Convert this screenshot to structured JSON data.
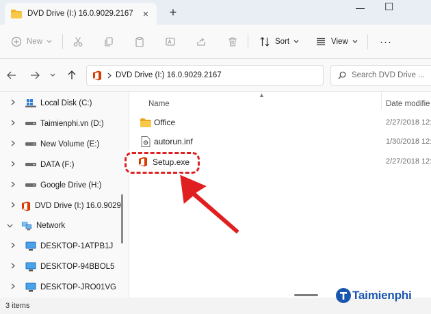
{
  "tab": {
    "title": "DVD Drive (I:) 16.0.9029.2167",
    "close_glyph": "×",
    "new_tab_glyph": "+"
  },
  "window_controls": {
    "minimize": "—",
    "maximize": "☐"
  },
  "command_bar": {
    "new_label": "New",
    "sort_label": "Sort",
    "view_label": "View",
    "more_glyph": "···"
  },
  "address": {
    "path": "DVD Drive (I:) 16.0.9029.2167",
    "search_placeholder": "Search DVD Drive ..."
  },
  "sidebar": {
    "items": [
      {
        "label": "Local Disk (C:)",
        "icon": "windows-drive-icon"
      },
      {
        "label": "Taimienphi.vn (D:)",
        "icon": "drive-icon"
      },
      {
        "label": "New Volume (E:)",
        "icon": "drive-icon"
      },
      {
        "label": "DATA (F:)",
        "icon": "drive-icon"
      },
      {
        "label": "Google Drive (H:)",
        "icon": "drive-icon"
      },
      {
        "label": "DVD Drive (I:) 16.0.9029.",
        "icon": "office-icon"
      },
      {
        "label": "Network",
        "icon": "network-icon"
      },
      {
        "label": "DESKTOP-1ATPB1J",
        "icon": "computer-icon"
      },
      {
        "label": "DESKTOP-94BBOL5",
        "icon": "computer-icon"
      },
      {
        "label": "DESKTOP-JRO01VG",
        "icon": "computer-icon"
      }
    ]
  },
  "columns": {
    "name": "Name",
    "date": "Date modifie"
  },
  "files": [
    {
      "name": "Office",
      "date": "2/27/2018 12:2",
      "icon": "folder-icon"
    },
    {
      "name": "autorun.inf",
      "date": "1/30/2018 12:5",
      "icon": "settings-file-icon"
    },
    {
      "name": "Setup.exe",
      "date": "2/27/2018 12:2",
      "icon": "office-icon"
    }
  ],
  "status": {
    "items_count": "3 items"
  },
  "watermark": {
    "text": "Taimienphi"
  },
  "colors": {
    "highlight_red": "#e02020",
    "office_orange": "#d83b01",
    "folder_yellow": "#f0b429",
    "watermark_blue": "#1a56b0"
  }
}
